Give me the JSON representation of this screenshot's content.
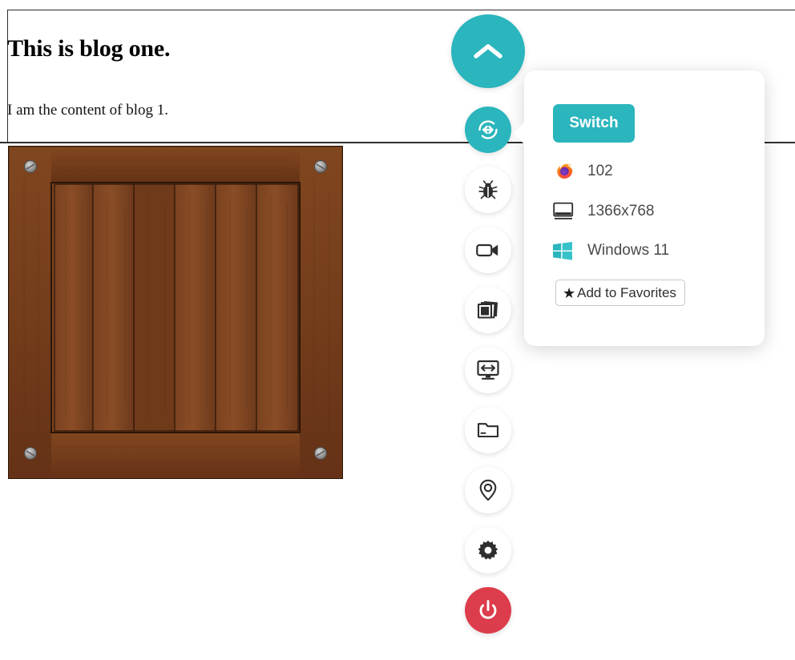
{
  "page": {
    "background_color": "#ffffff",
    "blog": {
      "title": "This is blog one.",
      "body": "I am the content of blog 1.",
      "image_alt": "wooden crate"
    }
  },
  "toolbar": {
    "accent_color": "#2BB5BD",
    "danger_color": "#DC3C4C",
    "items": [
      {
        "name": "collapse-toolbar-button",
        "icon": "chevron-up-icon",
        "style": "teal-large"
      },
      {
        "name": "switch-session-button",
        "icon": "switch-icon",
        "style": "teal"
      },
      {
        "name": "report-bug-button",
        "icon": "bug-icon",
        "style": "white"
      },
      {
        "name": "record-video-button",
        "icon": "video-camera-icon",
        "style": "white"
      },
      {
        "name": "screenshots-button",
        "icon": "screenshots-stack-icon",
        "style": "white"
      },
      {
        "name": "resize-screen-button",
        "icon": "monitor-resize-icon",
        "style": "white"
      },
      {
        "name": "files-button",
        "icon": "folder-icon",
        "style": "white"
      },
      {
        "name": "location-button",
        "icon": "location-pin-icon",
        "style": "white"
      },
      {
        "name": "settings-button",
        "icon": "gear-icon",
        "style": "white"
      },
      {
        "name": "power-button",
        "icon": "power-icon",
        "style": "red"
      }
    ]
  },
  "popup": {
    "switch_label": "Switch",
    "rows": [
      {
        "icon": "firefox-icon",
        "value": "102"
      },
      {
        "icon": "monitor-icon",
        "value": "1366x768"
      },
      {
        "icon": "windows-icon",
        "value": "Windows 11"
      }
    ],
    "favorites_star": "★",
    "favorites_label": "Add to Favorites"
  }
}
